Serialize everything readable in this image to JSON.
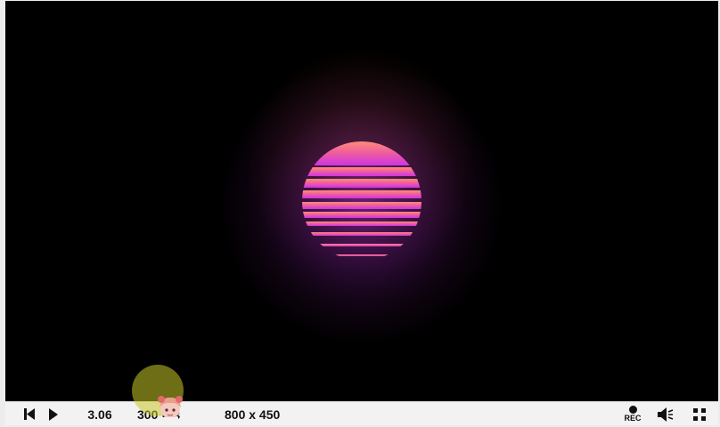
{
  "viewer": {
    "time": "3.06",
    "fps": "300 fps",
    "resolution": "800 x 450",
    "rec_label": "REC"
  },
  "icons": {
    "rewind": "skip-to-start-icon",
    "play": "play-icon",
    "record": "record-icon",
    "volume": "volume-icon",
    "fullscreen": "fullscreen-icon"
  },
  "colors": {
    "canvas_background": "#000000",
    "sun_top": "#ff8a80",
    "sun_bottom": "#d63ae0",
    "glow": "#8a1fa8",
    "controls_background": "#f2f2f2"
  }
}
